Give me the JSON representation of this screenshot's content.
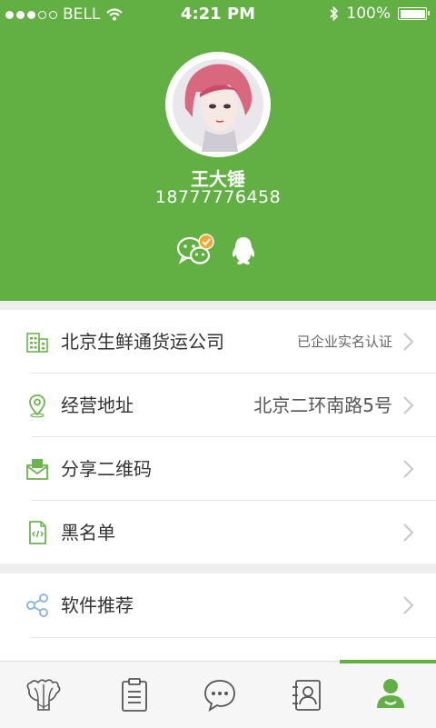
{
  "status_bar": {
    "carrier": "BELL",
    "time": "4:21 PM",
    "battery": "100%"
  },
  "profile": {
    "name": "王大锤",
    "phone": "18777776458"
  },
  "social_icons": [
    "wechat-icon",
    "qq-icon"
  ],
  "menu": {
    "company": {
      "label": "北京生鲜通货运公司",
      "value": "已企业实名认证"
    },
    "address": {
      "label": "经营地址",
      "value": "北京二环南路5号"
    },
    "qrcode": {
      "label": "分享二维码"
    },
    "blacklist": {
      "label": "黑名单"
    },
    "recommend": {
      "label": "软件推荐"
    }
  },
  "tabbar": {
    "tabs": [
      "cabbage-icon",
      "clipboard-icon",
      "chat-icon",
      "contacts-icon",
      "profile-icon"
    ],
    "active": "profile-icon"
  },
  "colors": {
    "accent": "#62b043",
    "background": "#eeeeee"
  }
}
